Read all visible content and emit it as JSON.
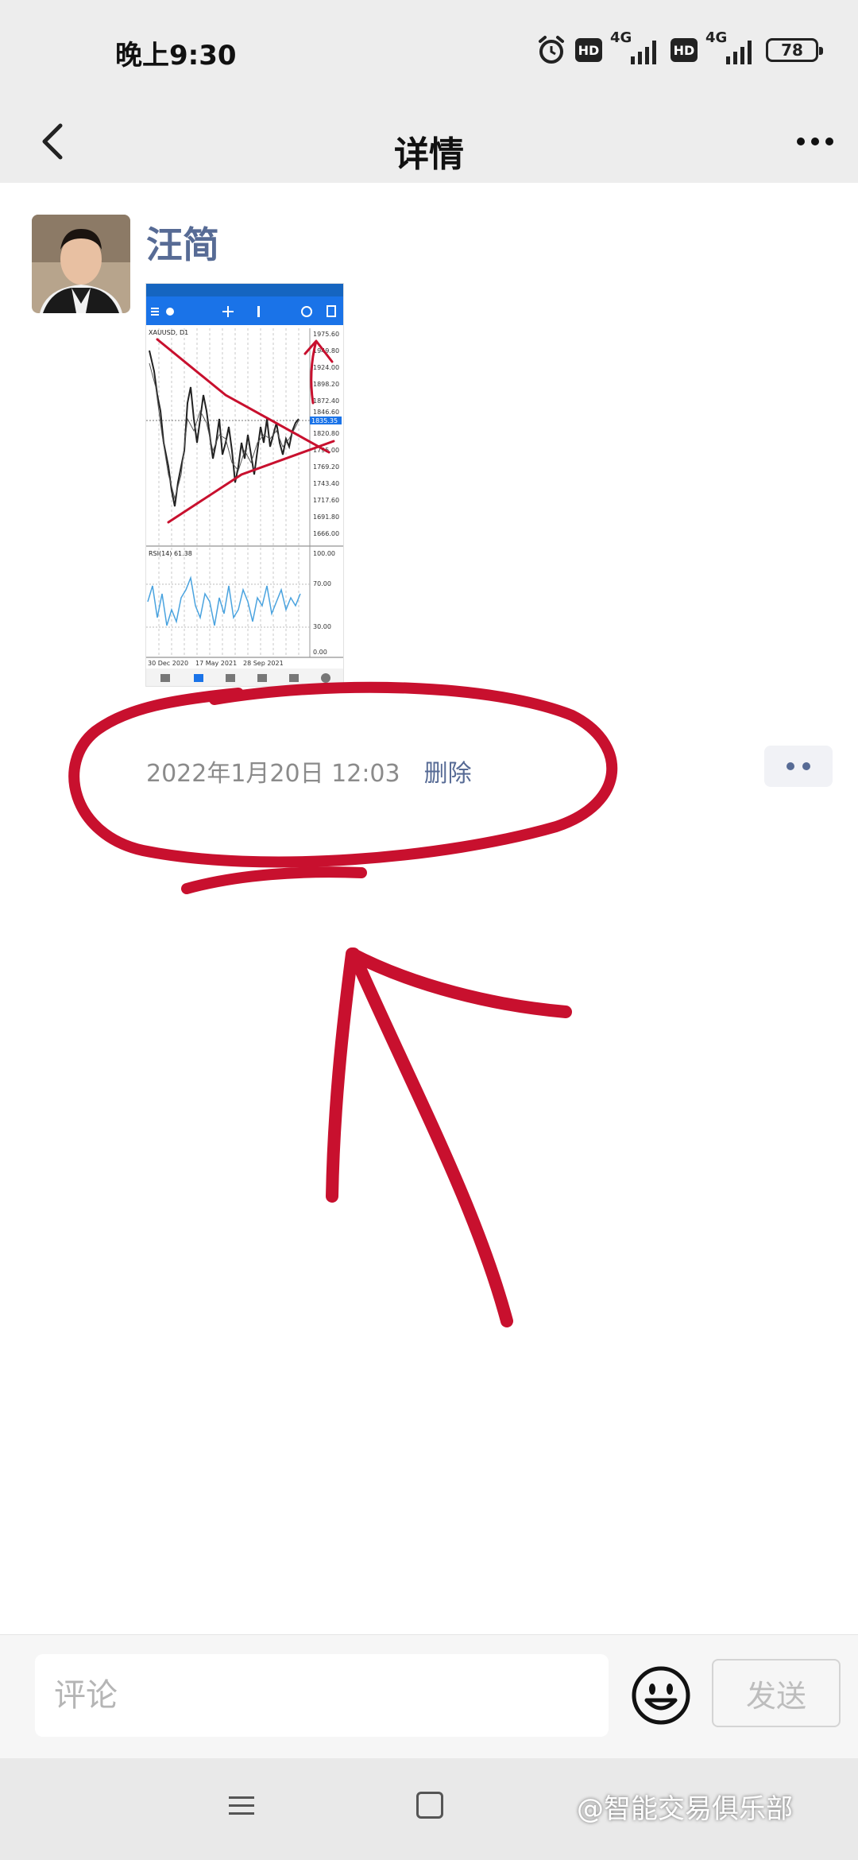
{
  "status_bar": {
    "time": "晚上9:30",
    "hd_badge": "HD",
    "network_label": "4G",
    "battery": "78"
  },
  "nav": {
    "title": "详情"
  },
  "post": {
    "author": "汪简",
    "timestamp": "2022年1月20日 12:03",
    "delete_label": "删除",
    "image": {
      "symbol_label": "XAUUSD, D1",
      "price_levels": [
        "1975.60",
        "1949.80",
        "1924.00",
        "1898.20",
        "1872.40",
        "1846.60",
        "1820.80",
        "1795.00",
        "1769.20",
        "1743.40",
        "1717.60",
        "1691.80",
        "1666.00"
      ],
      "current_price": "1835.35",
      "rsi_label": "RSI(14) 61.38",
      "rsi_levels": [
        "100.00",
        "70.00",
        "30.00",
        "0.00"
      ],
      "date_labels": [
        "30 Dec 2020",
        "17 May 2021",
        "28 Sep 2021"
      ]
    }
  },
  "comment_bar": {
    "placeholder": "评论",
    "send_label": "发送"
  },
  "watermark": "@智能交易俱乐部",
  "colors": {
    "link_blue": "#576b95",
    "annotation_red": "#c8102e",
    "chart_header_blue": "#1a73e8"
  }
}
